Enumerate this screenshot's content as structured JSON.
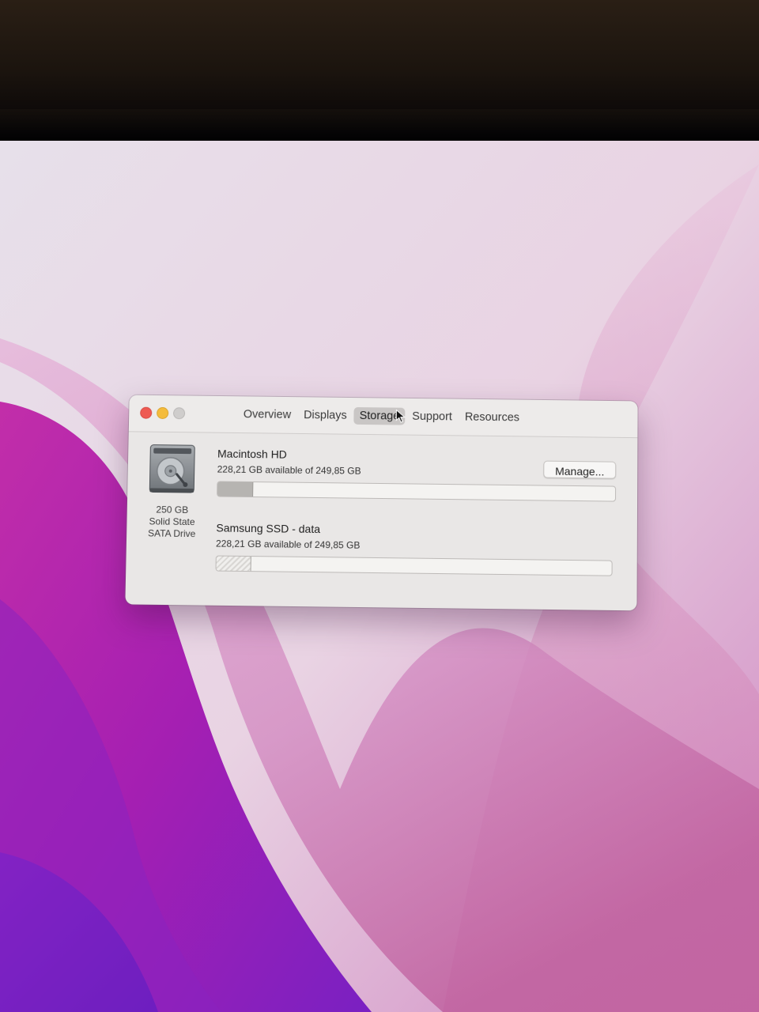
{
  "window": {
    "tabs": [
      {
        "label": "Overview"
      },
      {
        "label": "Displays"
      },
      {
        "label": "Storage"
      },
      {
        "label": "Support"
      },
      {
        "label": "Resources"
      }
    ],
    "active_tab": "Storage"
  },
  "drive": {
    "icon": "hard-drive-icon",
    "caption_line1": "250 GB",
    "caption_line2": "Solid State",
    "caption_line3": "SATA Drive"
  },
  "volumes": [
    {
      "name": "Macintosh HD",
      "detail": "228,21 GB available of 249,85 GB",
      "used_fraction": 0.087,
      "fill_style": "solid"
    },
    {
      "name": "Samsung SSD - data",
      "detail": "228,21 GB available of 249,85 GB",
      "used_fraction": 0.087,
      "fill_style": "hatched"
    }
  ],
  "manage_button": {
    "label": "Manage..."
  },
  "colors": {
    "close": "#ee5a52",
    "minimize": "#f4bc3c",
    "zoom_inactive": "#cfcdcc",
    "wallpaper_magenta": "#b1249e",
    "wallpaper_violet": "#5a1fb3"
  }
}
